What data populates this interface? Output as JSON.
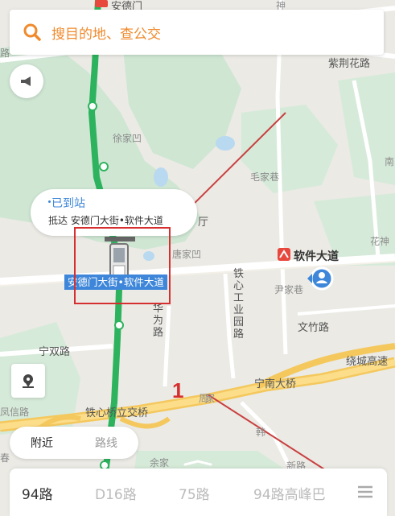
{
  "search": {
    "placeholder": "搜目的地、查公交"
  },
  "bubble": {
    "status": "已到站",
    "detail": "抵达 安德门大街•软件大道"
  },
  "station": {
    "label": "安德门大街•软件大道"
  },
  "map_labels": {
    "andemen_top": "安德门",
    "shen": "神",
    "zijinghua": "紫荆花路",
    "xujiaao": "徐家凹",
    "maojiaxiang": "毛家巷",
    "ting": "厅",
    "tangjiaao": "唐家凹",
    "ruanjian_metro": "软件大道",
    "yinjiaxiang": "尹家巷",
    "tiexin_road": "铁心工业园路",
    "huawei_road": "华为路",
    "wenzhu_road": "文竹路",
    "ningshuang_road": "宁双路",
    "ningnan_bridge": "宁南大桥",
    "raocheng": "绕城高速",
    "tiexinqiao": "铁心桥立交桥",
    "fengxin_road": "凤信路",
    "huashen": "花神",
    "zhou": "周",
    "han": "韩",
    "jia": "家",
    "chun": "春",
    "xinglu": "路",
    "nan": "南",
    "dudi_tuan": "新路",
    "yujia": "余家"
  },
  "annotation": {
    "number": "1"
  },
  "tabs": {
    "nearby": "附近",
    "route": "路线"
  },
  "routes": [
    "94路",
    "D16路",
    "75路",
    "94路高峰巴"
  ],
  "colors": {
    "accent": "#f08a2c",
    "metro": "#2db35d",
    "bus_blue": "#3d86d9",
    "annotation_red": "#d62f2f"
  }
}
